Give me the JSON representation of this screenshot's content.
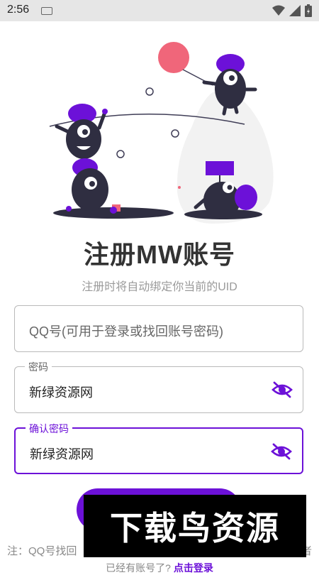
{
  "status_bar": {
    "time": "2:56"
  },
  "page": {
    "title": "注册MW账号",
    "subtitle": "注册时将自动绑定你当前的UID"
  },
  "form": {
    "qq_field": {
      "placeholder": "QQ号(可用于登录或找回账号密码)"
    },
    "password_field": {
      "label": "密码",
      "value": "新绿资源网"
    },
    "confirm_field": {
      "label": "确认密码",
      "value": "新绿资源网"
    }
  },
  "footer": {
    "note_start": "注：QQ号找回",
    "note_end": "者",
    "has_account": "已经有账号了?",
    "login_link": "点击登录"
  },
  "watermark": {
    "text": "下载鸟资源"
  },
  "colors": {
    "accent": "#6c11d8",
    "illustration_purple": "#6c11d8",
    "balloon": "#f0667a",
    "dark": "#2f2e41"
  }
}
